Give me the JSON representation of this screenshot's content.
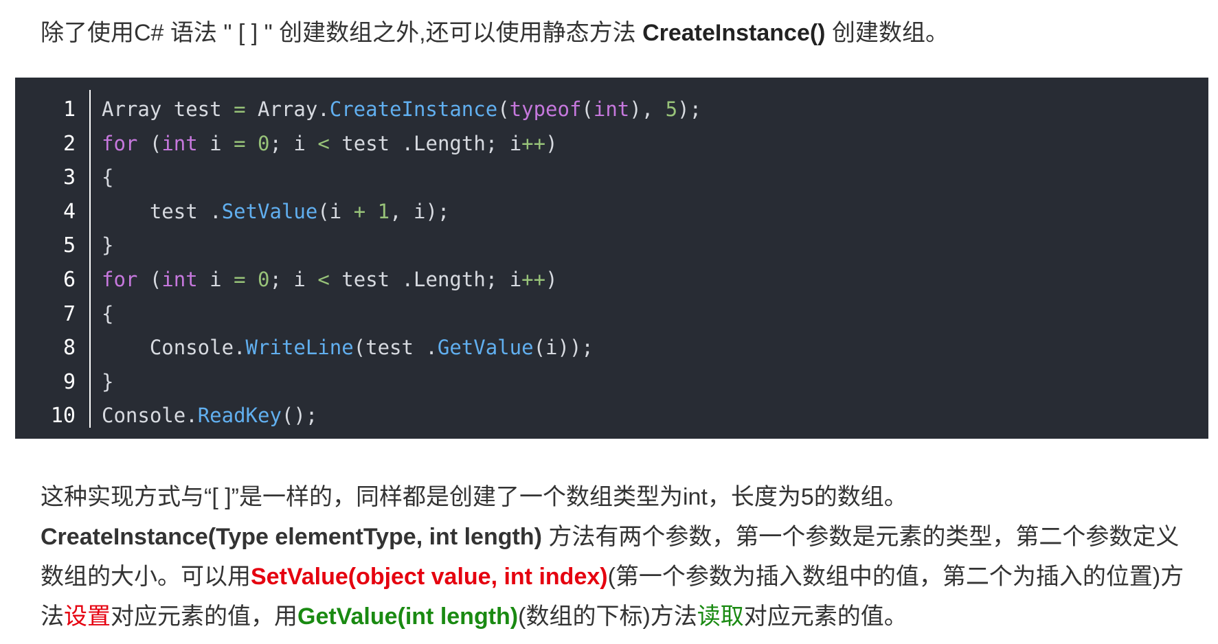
{
  "intro": {
    "text": "除了使用C# 语法 \" [ ] \" 创建数组之外,还可以使用静态方法 ",
    "bold": "CreateInstance()",
    "tail": " 创建数组。"
  },
  "code": {
    "line_numbers": [
      "1",
      "2",
      "3",
      "4",
      "5",
      "6",
      "7",
      "8",
      "9",
      "10"
    ],
    "lines": [
      [
        [
          "txt",
          "Array test "
        ],
        [
          "op",
          "="
        ],
        [
          "txt",
          " Array."
        ],
        [
          "fn",
          "CreateInstance"
        ],
        [
          "txt",
          "("
        ],
        [
          "kw",
          "typeof"
        ],
        [
          "txt",
          "("
        ],
        [
          "kw",
          "int"
        ],
        [
          "txt",
          "), "
        ],
        [
          "num",
          "5"
        ],
        [
          "txt",
          ");"
        ]
      ],
      [
        [
          "kw",
          "for"
        ],
        [
          "txt",
          " ("
        ],
        [
          "kw",
          "int"
        ],
        [
          "txt",
          " i "
        ],
        [
          "op",
          "="
        ],
        [
          "txt",
          " "
        ],
        [
          "num",
          "0"
        ],
        [
          "txt",
          "; i "
        ],
        [
          "op",
          "<"
        ],
        [
          "txt",
          " test .Length; i"
        ],
        [
          "op",
          "++"
        ],
        [
          "txt",
          ")"
        ]
      ],
      [
        [
          "txt",
          "{"
        ]
      ],
      [
        [
          "txt",
          "    test ."
        ],
        [
          "fn",
          "SetValue"
        ],
        [
          "txt",
          "(i "
        ],
        [
          "op",
          "+"
        ],
        [
          "txt",
          " "
        ],
        [
          "num",
          "1"
        ],
        [
          "txt",
          ", i);"
        ]
      ],
      [
        [
          "txt",
          "}"
        ]
      ],
      [
        [
          "kw",
          "for"
        ],
        [
          "txt",
          " ("
        ],
        [
          "kw",
          "int"
        ],
        [
          "txt",
          " i "
        ],
        [
          "op",
          "="
        ],
        [
          "txt",
          " "
        ],
        [
          "num",
          "0"
        ],
        [
          "txt",
          "; i "
        ],
        [
          "op",
          "<"
        ],
        [
          "txt",
          " test .Length; i"
        ],
        [
          "op",
          "++"
        ],
        [
          "txt",
          ")"
        ]
      ],
      [
        [
          "txt",
          "{"
        ]
      ],
      [
        [
          "txt",
          "    Console."
        ],
        [
          "fn",
          "WriteLine"
        ],
        [
          "txt",
          "(test ."
        ],
        [
          "fn",
          "GetValue"
        ],
        [
          "txt",
          "(i));"
        ]
      ],
      [
        [
          "txt",
          "}"
        ]
      ],
      [
        [
          "txt",
          "Console."
        ],
        [
          "fn",
          "ReadKey"
        ],
        [
          "txt",
          "();"
        ]
      ]
    ],
    "colors": {
      "background": "#282c34",
      "keyword": "#c678dd",
      "function": "#61afef",
      "number": "#98c379",
      "text": "#abb2bf"
    }
  },
  "para1": "这种实现方式与“[ ]”是一样的，同样都是创建了一个数组类型为int，长度为5的数组。",
  "para2": {
    "bold_sig": "CreateInstance(Type elementType, int length)",
    "t1": " 方法有两个参数，第一个参数是元素的类型，第二个参数定义数组的大小。可以用",
    "set_sig": "SetValue(object value, int index)",
    "t2": "(第一个参数为插入数组中的值，第二个为插入的位置)方法",
    "set_word": "设置",
    "t3": "对应元素的值，用",
    "get_sig": "GetValue(int length)",
    "t4": "(数组的下标)方法",
    "get_word": "读取",
    "t5": "对应元素的值。",
    "colors": {
      "red": "#e5000f",
      "green": "#1a8a12"
    }
  }
}
